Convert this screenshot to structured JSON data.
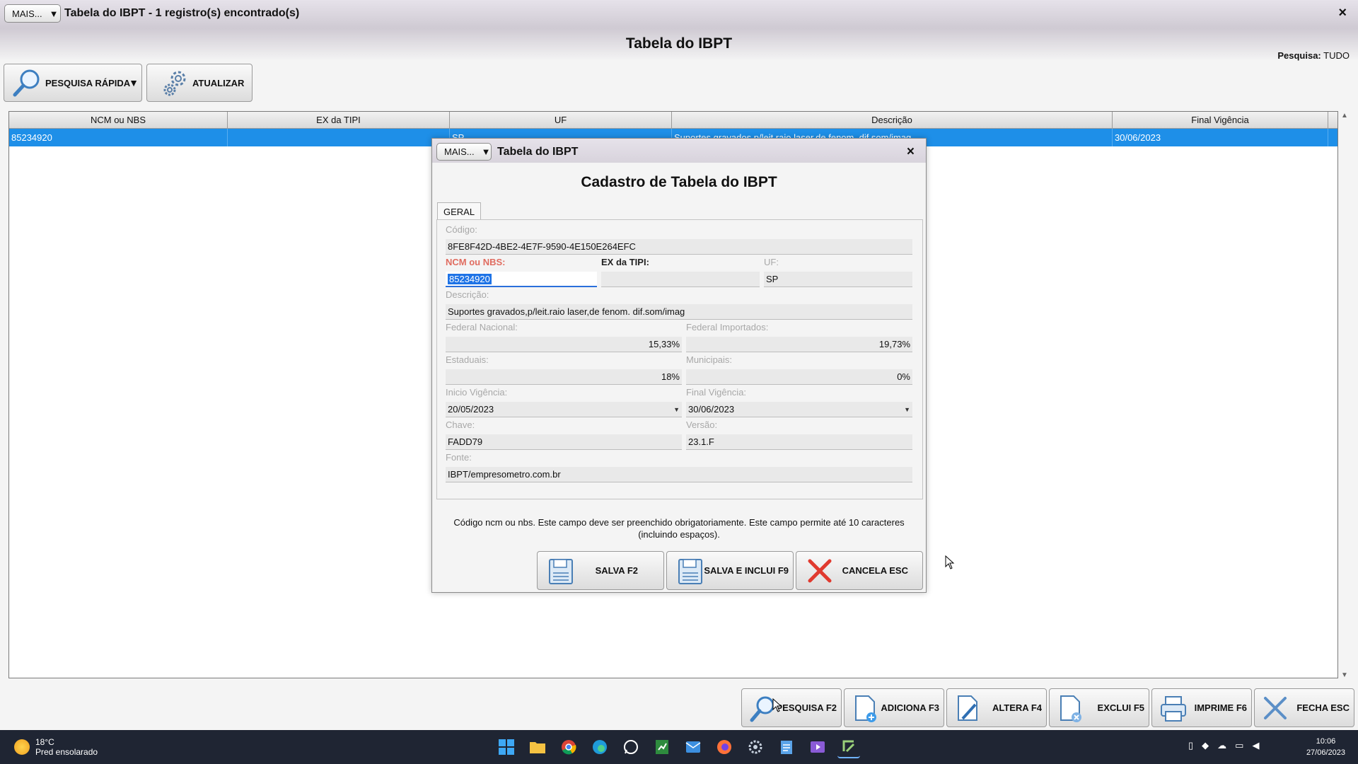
{
  "window": {
    "mais_label": "MAIS...",
    "title": "Tabela do IBPT - 1 registro(s) encontrado(s)",
    "close": "×",
    "page_title": "Tabela do IBPT",
    "search_mode_label": "Pesquisa:",
    "search_mode_value": "TUDO"
  },
  "toolbar": {
    "quick_search": "PESQUISA RÁPIDA",
    "update": "ATUALIZAR"
  },
  "grid": {
    "columns": [
      "NCM ou NBS",
      "EX da TIPI",
      "UF",
      "Descrição",
      "Final Vigência"
    ],
    "rows": [
      {
        "ncm": "85234920",
        "ex": "",
        "uf": "SP",
        "descricao": "Suportes gravados,p/leit.raio laser,de fenom. dif.som/imag",
        "final": "30/06/2023"
      }
    ]
  },
  "actions": {
    "search": "PESQUISA F2",
    "add": "ADICIONA F3",
    "edit": "ALTERA F4",
    "delete": "EXCLUI F5",
    "print": "IMPRIME F6",
    "close": "FECHA ESC"
  },
  "modal": {
    "mais_label": "MAIS...",
    "title": "Tabela do IBPT",
    "close": "×",
    "heading": "Cadastro de Tabela do IBPT",
    "tab": "GERAL",
    "labels": {
      "codigo": "Código:",
      "ncm": "NCM ou NBS:",
      "ex": "EX da TIPI:",
      "uf": "UF:",
      "descricao": "Descrição:",
      "federal_nacional": "Federal Nacional:",
      "federal_importados": "Federal Importados:",
      "estaduais": "Estaduais:",
      "municipais": "Municipais:",
      "inicio": "Inicio Vigência:",
      "final": "Final Vigência:",
      "chave": "Chave:",
      "versao": "Versão:",
      "fonte": "Fonte:"
    },
    "values": {
      "codigo": "8FE8F42D-4BE2-4E7F-9590-4E150E264EFC",
      "ncm": "85234920",
      "ex": "",
      "uf": "SP",
      "descricao": "Suportes gravados,p/leit.raio laser,de fenom. dif.som/imag",
      "federal_nacional": "15,33%",
      "federal_importados": "19,73%",
      "estaduais": "18%",
      "municipais": "0%",
      "inicio": "20/05/2023",
      "final": "30/06/2023",
      "chave": "FADD79",
      "versao": "23.1.F",
      "fonte": "IBPT/empresometro.com.br"
    },
    "hint": "Código ncm ou nbs. Este campo deve ser preenchido obrigatoriamente. Este campo permite até 10 caracteres (incluindo espaços).",
    "buttons": {
      "save": "SALVA F2",
      "save_new": "SALVA E INCLUI F9",
      "cancel": "CANCELA ESC"
    }
  },
  "taskbar": {
    "temp": "18°C",
    "weather": "Pred ensolarado",
    "time": "10:06",
    "date": "27/06/2023"
  },
  "colors": {
    "selection": "#1e8fe8",
    "required_label": "#e06c60",
    "cancel_icon": "#e03a2f"
  }
}
